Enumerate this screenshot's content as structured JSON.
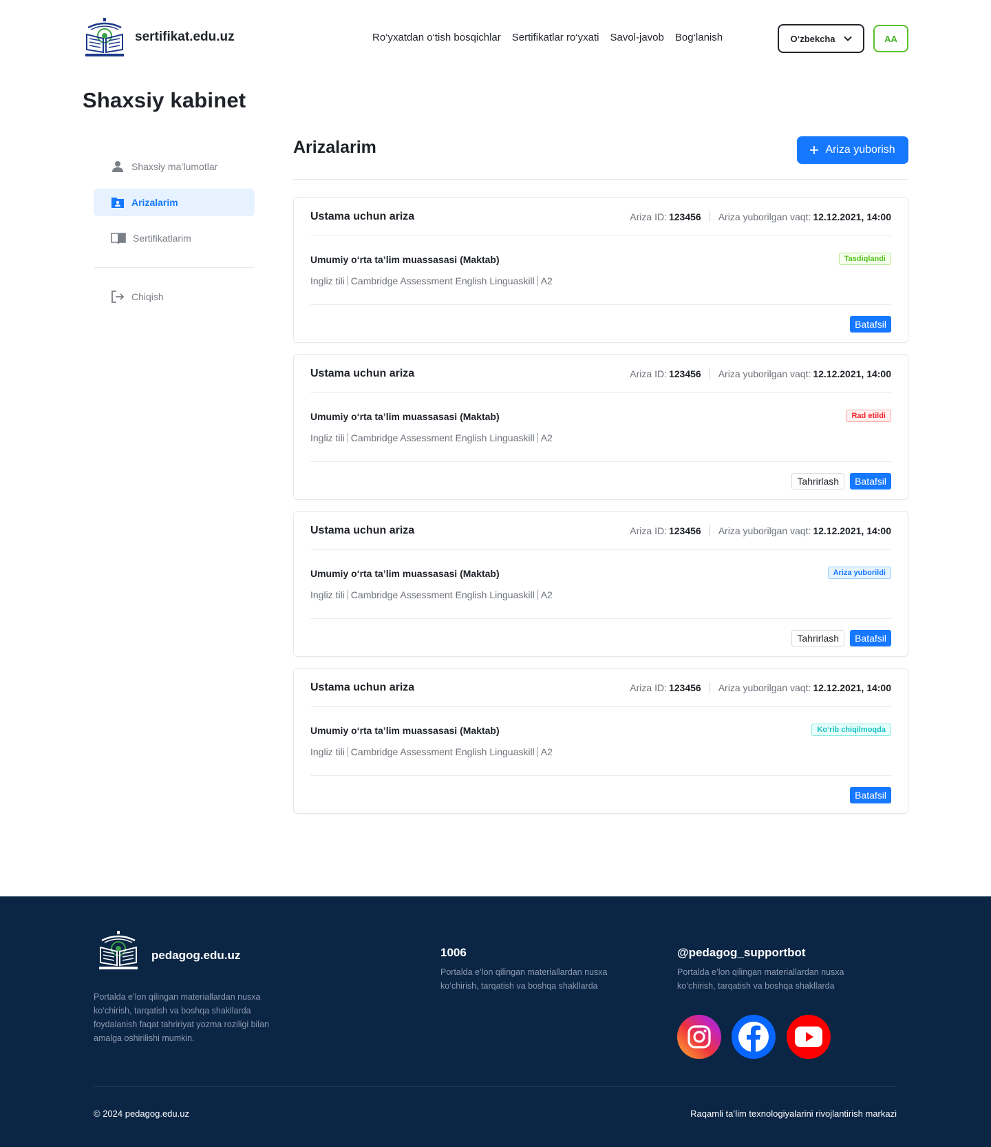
{
  "header": {
    "brand": "sertifikat.edu.uz",
    "nav": [
      "Ro‘yxatdan o‘tish bosqichlar",
      "Sertifikatlar ro‘yxati",
      "Savol-javob",
      "Bog‘lanish"
    ],
    "language": "O‘zbekcha",
    "font_size_button": "AA"
  },
  "page_title": "Shaxsiy kabinet",
  "sidebar": {
    "items": [
      {
        "label": "Shaxsiy ma’lumotlar",
        "icon": "user-icon"
      },
      {
        "label": "Arizalarim",
        "icon": "folder-user-icon",
        "active": true
      },
      {
        "label": "Sertifikatlarim",
        "icon": "book-icon"
      }
    ],
    "logout": {
      "label": "Chiqish",
      "icon": "logout-icon"
    }
  },
  "main": {
    "title": "Arizalarim",
    "submit_button": "Ariza yuborish",
    "cards": [
      {
        "title": "Ustama uchun ariza",
        "id_label": "Ariza ID:",
        "id_value": "123456",
        "time_label": "Ariza yuborilgan vaqt:",
        "time_value": "12.12.2021, 14:00",
        "org": "Umumiy o‘rta ta’lim muassasasi (Maktab)",
        "subject": "Ingliz tili",
        "exam": "Cambridge Assessment English Linguaskill",
        "level": "A2",
        "status": "Tasdiqlandi",
        "status_color": "#52c41a",
        "edit_label": "",
        "details_label": "Batafsil"
      },
      {
        "title": "Ustama uchun ariza",
        "id_label": "Ariza ID:",
        "id_value": "123456",
        "time_label": "Ariza yuborilgan vaqt:",
        "time_value": "12.12.2021, 14:00",
        "org": "Umumiy o‘rta ta’lim muassasasi (Maktab)",
        "subject": "Ingliz tili",
        "exam": "Cambridge Assessment English Linguaskill",
        "level": "A2",
        "status": "Rad etildi",
        "status_color": "#f5222d",
        "edit_label": "Tahrirlash",
        "details_label": "Batafsil"
      },
      {
        "title": "Ustama uchun ariza",
        "id_label": "Ariza ID:",
        "id_value": "123456",
        "time_label": "Ariza yuborilgan vaqt:",
        "time_value": "12.12.2021, 14:00",
        "org": "Umumiy o‘rta ta’lim muassasasi (Maktab)",
        "subject": "Ingliz tili",
        "exam": "Cambridge Assessment English Linguaskill",
        "level": "A2",
        "status": "Ariza yuborildi",
        "status_color": "#1677ff",
        "edit_label": "Tahrirlash",
        "details_label": "Batafsil"
      },
      {
        "title": "Ustama uchun ariza",
        "id_label": "Ariza ID:",
        "id_value": "123456",
        "time_label": "Ariza yuborilgan vaqt:",
        "time_value": "12.12.2021, 14:00",
        "org": "Umumiy o‘rta ta’lim muassasasi (Maktab)",
        "subject": "Ingliz tili",
        "exam": "Cambridge Assessment English Linguaskill",
        "level": "A2",
        "status": "Ko‘rib chiqilmoqda",
        "status_color": "#13c2c2",
        "edit_label": "",
        "details_label": "Batafsil"
      }
    ]
  },
  "footer": {
    "brand": "pedagog.edu.uz",
    "description": "Portalda e’lon qilingan materiallardan nusxa ko‘chirish, tarqatish va boshqa shakllarda foydalanish faqat tahririyat yozma roziligi bilan amalga oshirilishi mumkin.",
    "phone": "1006",
    "phone_text": "Portalda e’lon qilingan materiallardan nusxa ko‘chirish, tarqatish va boshqa shakllarda",
    "bot": "@pedagog_supportbot",
    "bot_text": "Portalda e’lon qilingan materiallardan nusxa ko‘chirish, tarqatish va boshqa shakllarda",
    "socials": [
      "instagram-icon",
      "facebook-icon",
      "youtube-icon"
    ],
    "copyright": "© 2024 pedagog.edu.uz",
    "org": "Raqamli ta’lim texnologiyalarini rivojlantirish markazi"
  },
  "colors": {
    "accent": "#1677ff",
    "footer_bg": "#0b2545",
    "success": "#52c41a"
  }
}
